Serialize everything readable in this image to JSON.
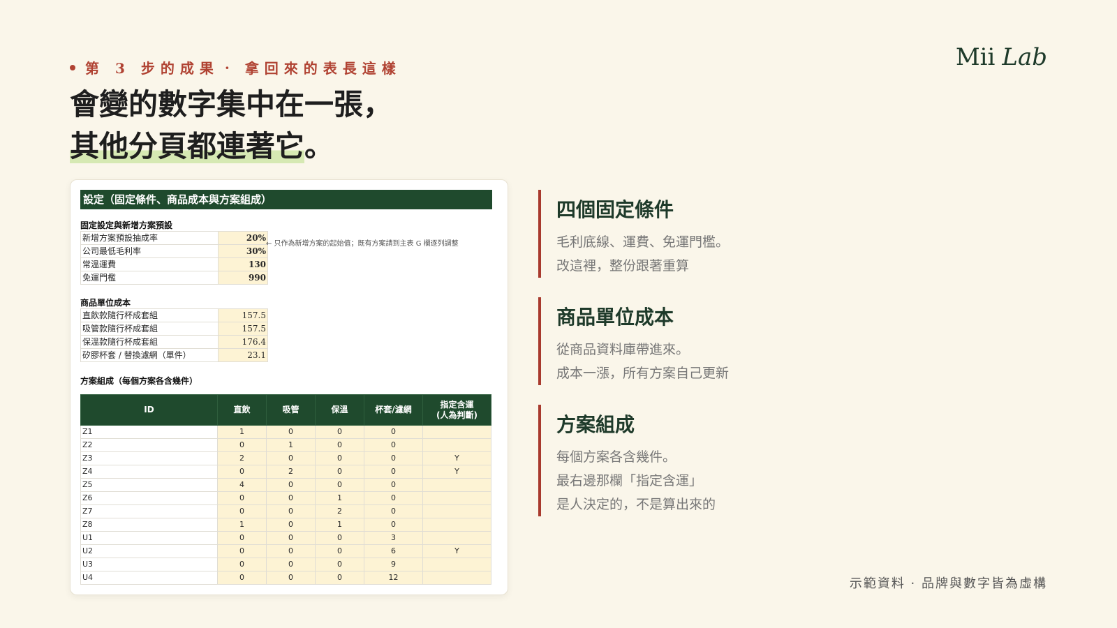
{
  "kicker": {
    "step": "第 3 步的成果",
    "separator": "·",
    "tail": "拿回來的表長這樣"
  },
  "brand": {
    "name": "Mii",
    "suffix": "Lab"
  },
  "headline": {
    "line1": "會變的數字集中在一張，",
    "line2_highlight": "其他分頁都連著它",
    "line2_end": "。"
  },
  "sheet": {
    "title": "設定（固定條件、商品成本與方案組成）",
    "fixed": {
      "heading": "固定設定與新增方案預設",
      "note": "← 只作為新增方案的起始值；既有方案請到主表 G 欄逐列調整",
      "rows": [
        {
          "label": "新增方案預設抽成率",
          "value": "20%"
        },
        {
          "label": "公司最低毛利率",
          "value": "30%"
        },
        {
          "label": "常溫運費",
          "value": "130"
        },
        {
          "label": "免運門檻",
          "value": "990"
        }
      ]
    },
    "costs": {
      "heading": "商品單位成本",
      "rows": [
        {
          "label": "直飲款隨行杯成套組",
          "value": "157.5"
        },
        {
          "label": "吸管款隨行杯成套組",
          "value": "157.5"
        },
        {
          "label": "保溫款隨行杯成套組",
          "value": "176.4"
        },
        {
          "label": "矽膠杯套 / 替換濾網（單件）",
          "value": "23.1"
        }
      ]
    },
    "plans": {
      "heading": "方案組成（每個方案各含幾件）",
      "columns": [
        "ID",
        "直飲",
        "吸管",
        "保溫",
        "杯套/濾網",
        "指定含運\n(人為判斷)"
      ],
      "rows": [
        [
          "Z1",
          "1",
          "0",
          "0",
          "0",
          ""
        ],
        [
          "Z2",
          "0",
          "1",
          "0",
          "0",
          ""
        ],
        [
          "Z3",
          "2",
          "0",
          "0",
          "0",
          "Y"
        ],
        [
          "Z4",
          "0",
          "2",
          "0",
          "0",
          "Y"
        ],
        [
          "Z5",
          "4",
          "0",
          "0",
          "0",
          ""
        ],
        [
          "Z6",
          "0",
          "0",
          "1",
          "0",
          ""
        ],
        [
          "Z7",
          "0",
          "0",
          "2",
          "0",
          ""
        ],
        [
          "Z8",
          "1",
          "0",
          "1",
          "0",
          ""
        ],
        [
          "U1",
          "0",
          "0",
          "0",
          "3",
          ""
        ],
        [
          "U2",
          "0",
          "0",
          "0",
          "6",
          "Y"
        ],
        [
          "U3",
          "0",
          "0",
          "0",
          "9",
          ""
        ],
        [
          "U4",
          "0",
          "0",
          "0",
          "12",
          ""
        ]
      ]
    }
  },
  "cards": [
    {
      "title": "四個固定條件",
      "lines": [
        "毛利底線、運費、免運門檻。",
        "改這裡，整份跟著重算"
      ]
    },
    {
      "title": "商品單位成本",
      "lines": [
        "從商品資料庫帶進來。",
        "成本一漲，所有方案自己更新"
      ]
    },
    {
      "title": "方案組成",
      "lines": [
        "每個方案各含幾件。",
        "最右邊那欄「指定含運」",
        "是人決定的，不是算出來的"
      ]
    }
  ],
  "footer": "示範資料 · 品牌與數字皆為虛構",
  "colors": {
    "accent": "#b04232",
    "sheet_header": "#1f4a2d",
    "cell_fill": "#fdf3d4",
    "background": "#faf6ea",
    "highlight": "#d6e9b3"
  }
}
